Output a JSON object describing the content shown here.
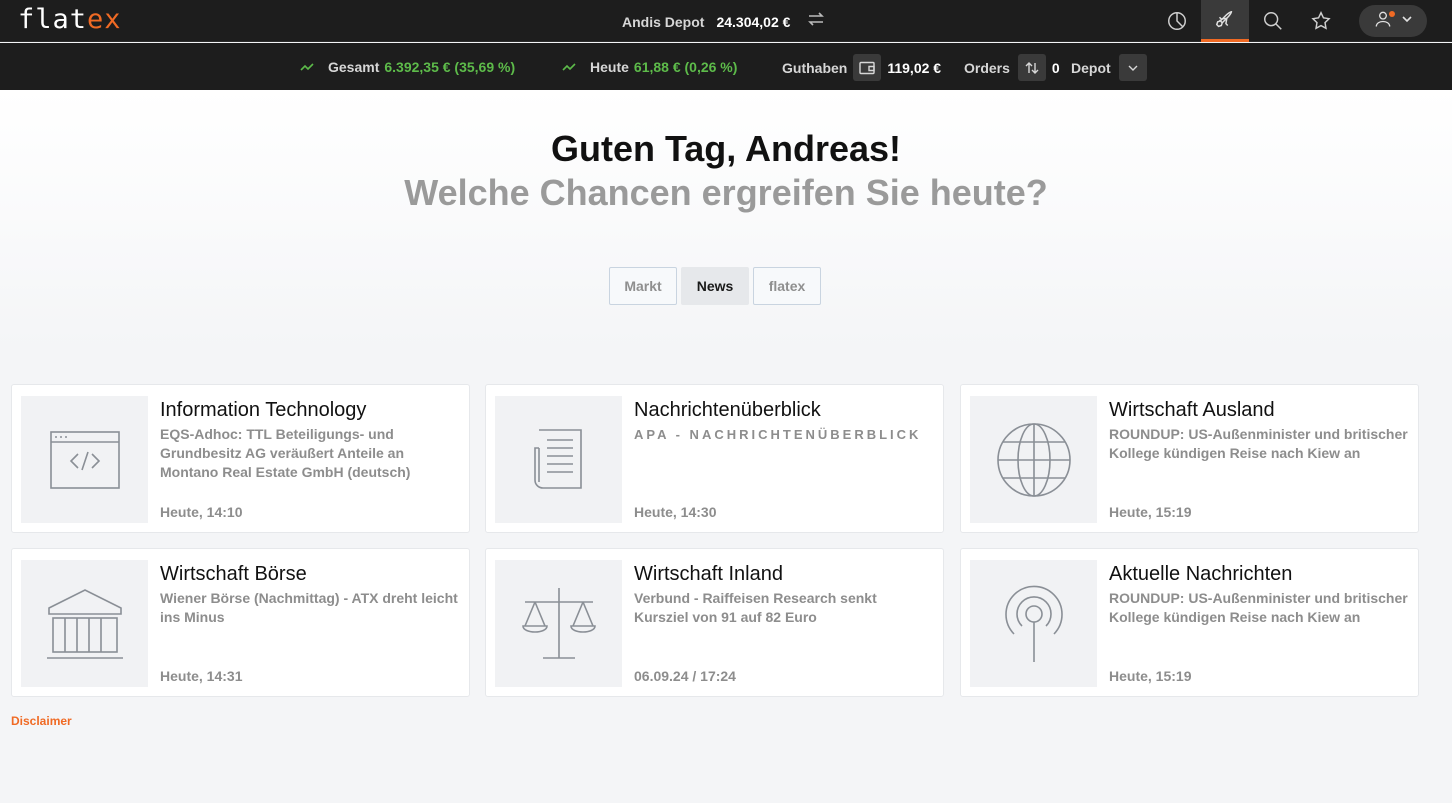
{
  "header": {
    "logo_main": "flat",
    "logo_accent": "ex",
    "depot_name": "Andis Depot",
    "depot_value": "24.304,02 €",
    "icons": [
      "portfolio-pie-icon",
      "rocket-icon",
      "search-icon",
      "star-icon",
      "user-icon"
    ]
  },
  "stats": {
    "gesamt_label": "Gesamt",
    "gesamt_value": "6.392,35 € (35,69 %)",
    "heute_label": "Heute",
    "heute_value": "61,88 € (0,26 %)",
    "guthaben_label": "Guthaben",
    "guthaben_value": "119,02 €",
    "orders_label": "Orders",
    "orders_value": "0",
    "depot_label": "Depot",
    "positive_color": "#5dbb4a"
  },
  "hero": {
    "greeting": "Guten Tag, Andreas!",
    "subtitle": "Welche Chancen ergreifen Sie heute?"
  },
  "tabs": [
    {
      "label": "Markt",
      "active": false
    },
    {
      "label": "News",
      "active": true
    },
    {
      "label": "flatex",
      "active": false
    }
  ],
  "cards": [
    {
      "title": "Information Technology",
      "desc": "EQS-Adhoc: TTL Beteiligungs- und Grundbesitz AG veräußert Anteile an Montano Real Estate GmbH (deutsch)",
      "time": "Heute, 14:10",
      "icon": "code-window-icon"
    },
    {
      "title": "Nachrichtenüberblick",
      "desc": "APA - NACHRICHTENÜBERBLICK",
      "time": "Heute, 14:30",
      "icon": "newspaper-icon"
    },
    {
      "title": "Wirtschaft Ausland",
      "desc": "ROUNDUP: US-Außenminister und britischer Kollege kündigen Reise nach Kiew an",
      "time": "Heute, 15:19",
      "icon": "globe-icon"
    },
    {
      "title": "Wirtschaft Börse",
      "desc": "Wiener Börse (Nachmittag) - ATX dreht leicht ins Minus",
      "time": "Heute, 14:31",
      "icon": "bank-building-icon"
    },
    {
      "title": "Wirtschaft Inland",
      "desc": "Verbund - Raiffeisen Research senkt Kursziel von 91 auf 82 Euro",
      "time": "06.09.24 / 17:24",
      "icon": "scales-icon"
    },
    {
      "title": "Aktuelle Nachrichten",
      "desc": "ROUNDUP: US-Außenminister und britischer Kollege kündigen Reise nach Kiew an",
      "time": "Heute, 15:19",
      "icon": "broadcast-icon"
    }
  ],
  "footer": {
    "disclaimer": "Disclaimer",
    "accent_color": "#f06a24"
  }
}
